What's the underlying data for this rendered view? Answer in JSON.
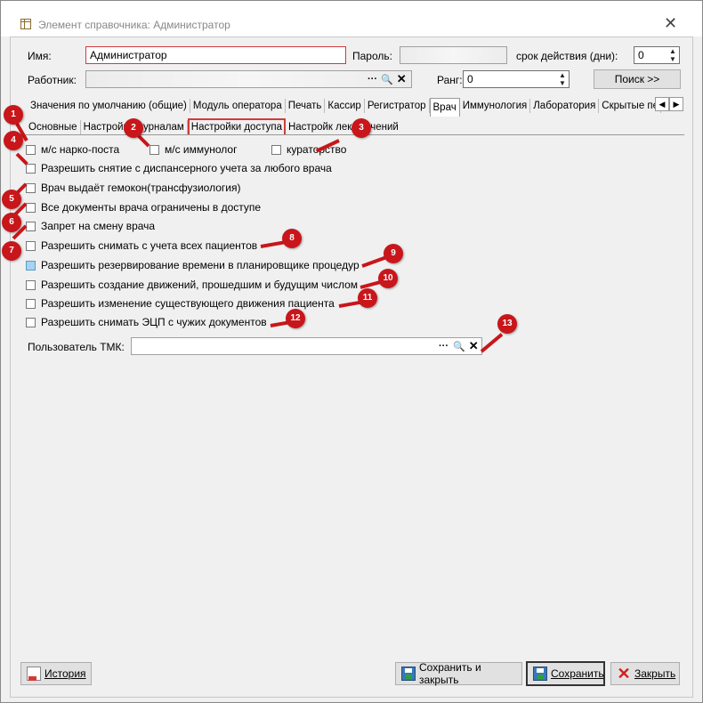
{
  "window": {
    "title": "Элемент справочника: Администратор"
  },
  "form": {
    "name_label": "Имя:",
    "name_value": "Администратор",
    "password_label": "Пароль:",
    "validity_label": "срок действия (дни):",
    "validity_value": "0",
    "worker_label": "Работник:",
    "rank_label": "Ранг:",
    "rank_value": "0",
    "search_button": "Поиск  >>"
  },
  "tabs": [
    {
      "label": "Значения по умолчанию (общие)"
    },
    {
      "label": "Модуль оператора"
    },
    {
      "label": "Печать"
    },
    {
      "label": "Кассир"
    },
    {
      "label": "Регистратор"
    },
    {
      "label": "Врач"
    },
    {
      "label": "Иммунология"
    },
    {
      "label": "Лаборатория"
    },
    {
      "label": "Скрытые печ"
    }
  ],
  "subtabs": [
    {
      "label": "Основные"
    },
    {
      "label": "Настройки журналам"
    },
    {
      "label": "Настройки доступа"
    },
    {
      "label": "Настройк лек   значений"
    }
  ],
  "checkboxes": {
    "narco": "м/с нарко-поста",
    "immunolog": "м/с иммунолог",
    "curator": "кураторство",
    "c4": "Разрешить снятие с диспансерного учета за любого врача",
    "c5": "Врач выдаёт гемокон(трансфузиология)",
    "c6": "Все документы врача ограничены в доступе",
    "c7": "Запрет на смену врача",
    "c8": "Разрешить снимать с учета всех пациентов",
    "c9": "Разрешить резервирование времени в планировщике процедур",
    "c10": "Разрешить создание движений, прошедшим и будущим числом",
    "c11": "Разрешить изменение существующего движения пациента",
    "c12": "Разрешить снимать ЭЦП с чужих документов"
  },
  "tmk": {
    "label": "Пользователь ТМК:",
    "icons": "···"
  },
  "markers": [
    "1",
    "2",
    "3",
    "4",
    "5",
    "6",
    "7",
    "8",
    "9",
    "10",
    "11",
    "12",
    "13"
  ],
  "buttons": {
    "history": "История",
    "save_close": "Сохранить и закрыть",
    "save": "Сохранить",
    "close": "Закрыть"
  },
  "colors": {
    "marker": "#c8161b",
    "highlight_border": "#d23a3a"
  }
}
